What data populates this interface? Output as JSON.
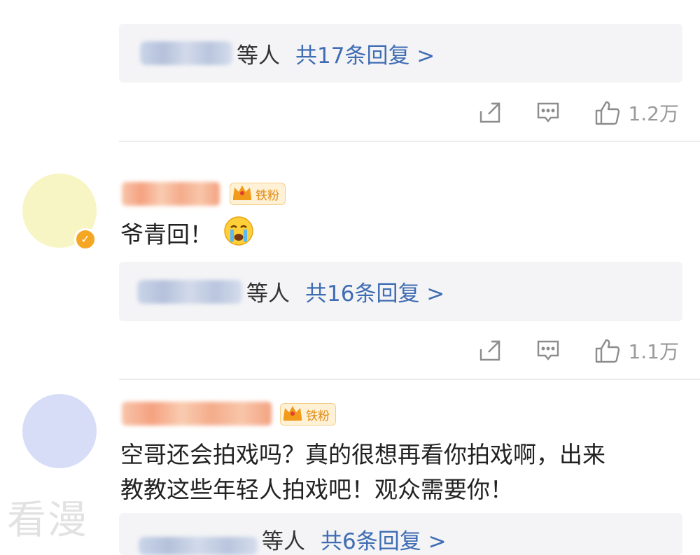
{
  "threads": [
    {
      "reply_summary": {
        "suffix": "等人",
        "link": "共17条回复 >"
      },
      "actions": {
        "likes": "1.2万"
      }
    },
    {
      "author": {
        "badge": "铁粉",
        "verified": true,
        "avatar_color": "#f8f5c4"
      },
      "comment": "爷青回！",
      "emoji": "crying-face",
      "reply_summary": {
        "suffix": "等人",
        "link": "共16条回复 >"
      },
      "actions": {
        "likes": "1.1万"
      }
    },
    {
      "author": {
        "badge": "铁粉",
        "verified": false,
        "avatar_color": "#d7ddf7"
      },
      "comment_lines": [
        "空哥还会拍戏吗？真的很想再看你拍戏啊，出来",
        "教教这些年轻人拍戏吧！观众需要你！"
      ],
      "reply_summary": {
        "suffix": "等人",
        "link": "共6条回复 >"
      }
    }
  ],
  "watermark": "看漫",
  "colors": {
    "link": "#3f6db3",
    "badge": "#e08a10",
    "reply_bg": "#f4f4f6"
  }
}
